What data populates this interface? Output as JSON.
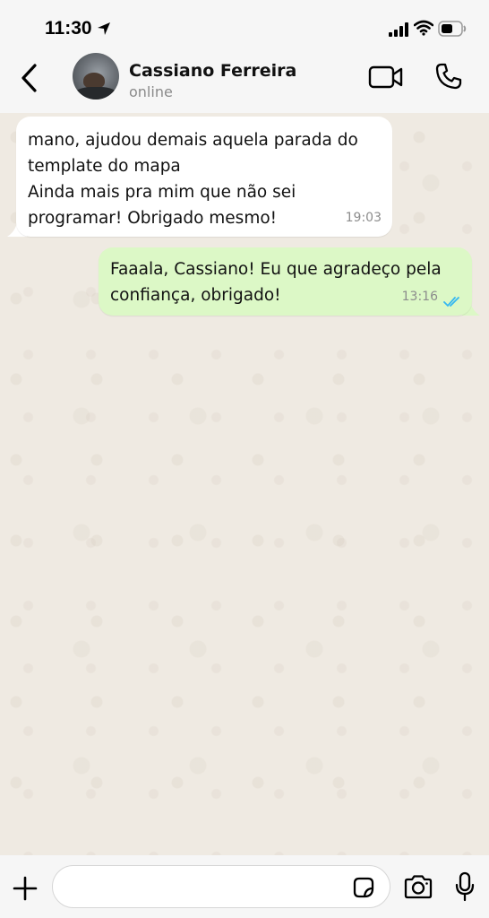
{
  "status_bar": {
    "time": "11:30",
    "icons": [
      "location-arrow-icon",
      "signal-icon",
      "wifi-icon",
      "battery-icon"
    ]
  },
  "header": {
    "contact_name": "Cassiano Ferreira",
    "contact_status": "online",
    "icons": [
      "back-icon",
      "video-call-icon",
      "voice-call-icon"
    ]
  },
  "messages": [
    {
      "direction": "incoming",
      "text": "mano, ajudou demais aquela parada do\ntemplate do mapa\nAinda mais pra mim que não sei\nprogramar! Obrigado mesmo!",
      "time": "19:03"
    },
    {
      "direction": "outgoing",
      "text": "Faaala, Cassiano! Eu que agradeço pela\nconfiança, obrigado!",
      "time": "13:16",
      "status": "read"
    }
  ],
  "input_bar": {
    "placeholder": "",
    "icons": [
      "plus-icon",
      "sticker-icon",
      "camera-icon",
      "microphone-icon"
    ]
  },
  "colors": {
    "chat_background": "#efeae2",
    "incoming_bubble": "#ffffff",
    "outgoing_bubble": "#dcf8c6",
    "read_ticks": "#34b7f1"
  }
}
